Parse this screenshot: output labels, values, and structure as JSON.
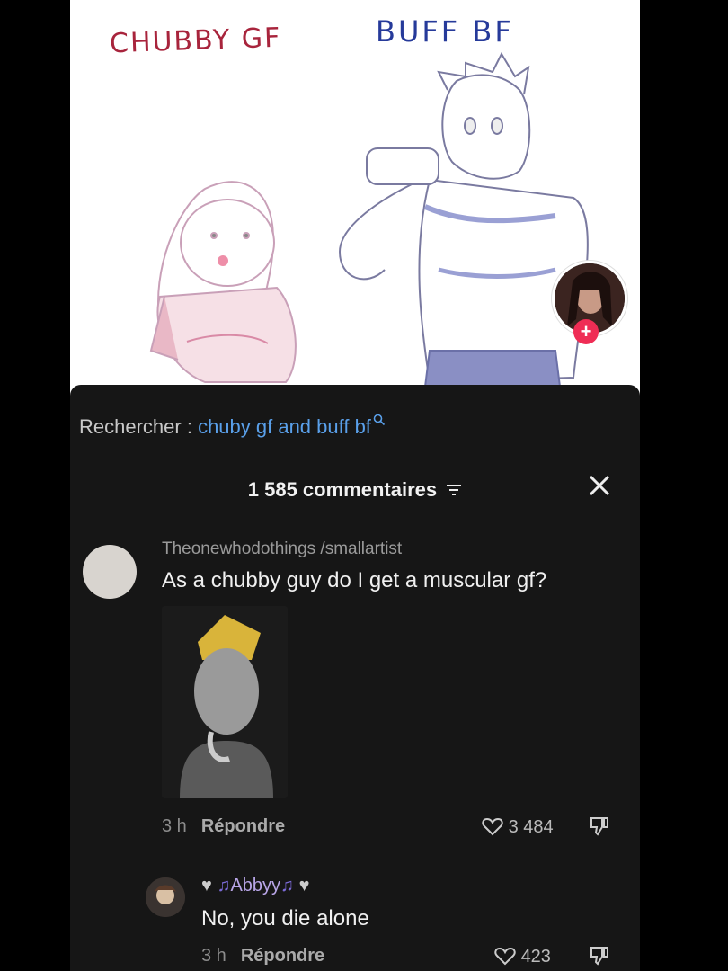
{
  "artwork": {
    "label_left": "CHUBBY GF",
    "label_right": "BUFF BF"
  },
  "search": {
    "prefix": "Rechercher : ",
    "query": "chuby gf and buff bf"
  },
  "comments": {
    "count_label": "1 585 commentaires",
    "items": [
      {
        "user": "Theonewhodothings /smallartist",
        "text": "As a chubby guy do I get a muscular gf?",
        "time": "3 h",
        "reply_label": "Répondre",
        "likes": "3 484"
      },
      {
        "user": "Abbyy",
        "text": "No, you die alone",
        "time": "3 h",
        "reply_label": "Répondre",
        "likes": "423"
      }
    ]
  },
  "colors": {
    "panel_bg": "#161616",
    "accent_link": "#5aa0ea",
    "follow_plus": "#ef2d55"
  }
}
